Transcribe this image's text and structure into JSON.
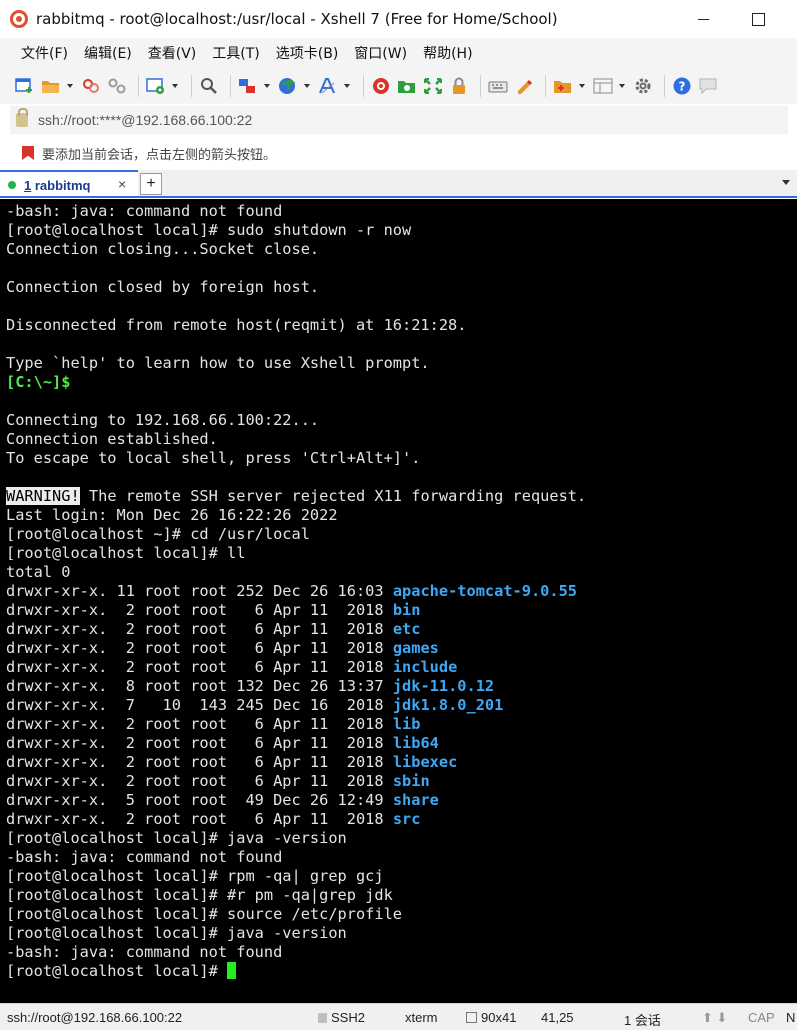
{
  "window": {
    "title": "rabbitmq - root@localhost:/usr/local - Xshell 7 (Free for Home/School)"
  },
  "menu": {
    "items": [
      "文件(F)",
      "编辑(E)",
      "查看(V)",
      "工具(T)",
      "选项卡(B)",
      "窗口(W)",
      "帮助(H)"
    ]
  },
  "toolbar": {
    "icons": [
      "new-session-icon",
      "open-folder-icon",
      "reconnect-icon",
      "disconnect-icon",
      "properties-icon",
      "find-icon",
      "transfer-icon",
      "globe-icon",
      "font-icon",
      "xshell-icon",
      "xftp-icon",
      "fullscreen-icon",
      "lock-icon",
      "keyboard-icon",
      "highlight-icon",
      "script-icon",
      "layout-icon",
      "settings-icon",
      "help-icon",
      "chat-icon"
    ],
    "colors": {
      "green": "#2e9f3e",
      "red": "#d9342b",
      "blue": "#2f6edc",
      "orange": "#e8952b",
      "gray": "#8a8a8a"
    }
  },
  "address": {
    "value": "ssh://root:****@192.168.66.100:22"
  },
  "hint": {
    "text": "要添加当前会话，点击左侧的箭头按钮。"
  },
  "tab": {
    "number": "1",
    "name": "rabbitmq",
    "close": "×",
    "add": "+"
  },
  "terminal": {
    "colors": {
      "background": "#000000",
      "foreground": "#e4e4e4",
      "prompt_green": "#4fe84f",
      "directory_blue": "#3fa8f5",
      "cursor": "#22ee22"
    },
    "lines": [
      [
        {
          "t": "-bash: java: command not found"
        }
      ],
      [
        {
          "t": "[root@localhost local]# sudo shutdown -r now"
        }
      ],
      [
        {
          "t": "Connection closing...Socket close."
        }
      ],
      [
        {
          "t": ""
        }
      ],
      [
        {
          "t": "Connection closed by foreign host."
        }
      ],
      [
        {
          "t": ""
        }
      ],
      [
        {
          "t": "Disconnected from remote host(reqmit) at 16:21:28."
        }
      ],
      [
        {
          "t": ""
        }
      ],
      [
        {
          "t": "Type `help' to learn how to use Xshell prompt."
        }
      ],
      [
        {
          "t": "[C:\\~]$",
          "c": "green"
        }
      ],
      [
        {
          "t": ""
        }
      ],
      [
        {
          "t": "Connecting to 192.168.66.100:22..."
        }
      ],
      [
        {
          "t": "Connection established."
        }
      ],
      [
        {
          "t": "To escape to local shell, press 'Ctrl+Alt+]'."
        }
      ],
      [
        {
          "t": ""
        }
      ],
      [
        {
          "t": "WARNING!",
          "c": "warn"
        },
        {
          "t": " The remote SSH server rejected X11 forwarding request."
        }
      ],
      [
        {
          "t": "Last login: Mon Dec 26 16:22:26 2022"
        }
      ],
      [
        {
          "t": "[root@localhost ~]# cd /usr/local"
        }
      ],
      [
        {
          "t": "[root@localhost local]# ll"
        }
      ],
      [
        {
          "t": "total 0"
        }
      ],
      [
        {
          "t": "drwxr-xr-x. 11 root root 252 Dec 26 16:03 "
        },
        {
          "t": "apache-tomcat-9.0.55",
          "c": "blue"
        }
      ],
      [
        {
          "t": "drwxr-xr-x.  2 root root   6 Apr 11  2018 "
        },
        {
          "t": "bin",
          "c": "blue"
        }
      ],
      [
        {
          "t": "drwxr-xr-x.  2 root root   6 Apr 11  2018 "
        },
        {
          "t": "etc",
          "c": "blue"
        }
      ],
      [
        {
          "t": "drwxr-xr-x.  2 root root   6 Apr 11  2018 "
        },
        {
          "t": "games",
          "c": "blue"
        }
      ],
      [
        {
          "t": "drwxr-xr-x.  2 root root   6 Apr 11  2018 "
        },
        {
          "t": "include",
          "c": "blue"
        }
      ],
      [
        {
          "t": "drwxr-xr-x.  8 root root 132 Dec 26 13:37 "
        },
        {
          "t": "jdk-11.0.12",
          "c": "blue"
        }
      ],
      [
        {
          "t": "drwxr-xr-x.  7   10  143 245 Dec 16  2018 "
        },
        {
          "t": "jdk1.8.0_201",
          "c": "blue"
        }
      ],
      [
        {
          "t": "drwxr-xr-x.  2 root root   6 Apr 11  2018 "
        },
        {
          "t": "lib",
          "c": "blue"
        }
      ],
      [
        {
          "t": "drwxr-xr-x.  2 root root   6 Apr 11  2018 "
        },
        {
          "t": "lib64",
          "c": "blue"
        }
      ],
      [
        {
          "t": "drwxr-xr-x.  2 root root   6 Apr 11  2018 "
        },
        {
          "t": "libexec",
          "c": "blue"
        }
      ],
      [
        {
          "t": "drwxr-xr-x.  2 root root   6 Apr 11  2018 "
        },
        {
          "t": "sbin",
          "c": "blue"
        }
      ],
      [
        {
          "t": "drwxr-xr-x.  5 root root  49 Dec 26 12:49 "
        },
        {
          "t": "share",
          "c": "blue"
        }
      ],
      [
        {
          "t": "drwxr-xr-x.  2 root root   6 Apr 11  2018 "
        },
        {
          "t": "src",
          "c": "blue"
        }
      ],
      [
        {
          "t": "[root@localhost local]# java -version"
        }
      ],
      [
        {
          "t": "-bash: java: command not found"
        }
      ],
      [
        {
          "t": "[root@localhost local]# rpm -qa| grep gcj"
        }
      ],
      [
        {
          "t": "[root@localhost local]# #r pm -qa|grep jdk"
        }
      ],
      [
        {
          "t": "[root@localhost local]# source /etc/profile"
        }
      ],
      [
        {
          "t": "[root@localhost local]# java -version"
        }
      ],
      [
        {
          "t": "-bash: java: command not found"
        }
      ],
      [
        {
          "t": "[root@localhost local]# "
        },
        {
          "t": "",
          "c": "cursor"
        }
      ]
    ]
  },
  "status": {
    "address": "ssh://root@192.168.66.100:22",
    "protocol": "SSH2",
    "terminal": "xterm",
    "size": "90x41",
    "position": "41,25",
    "sessions": "1 会话",
    "arrows": "⬆ ⬇",
    "caps": "CAP",
    "num": "N"
  }
}
